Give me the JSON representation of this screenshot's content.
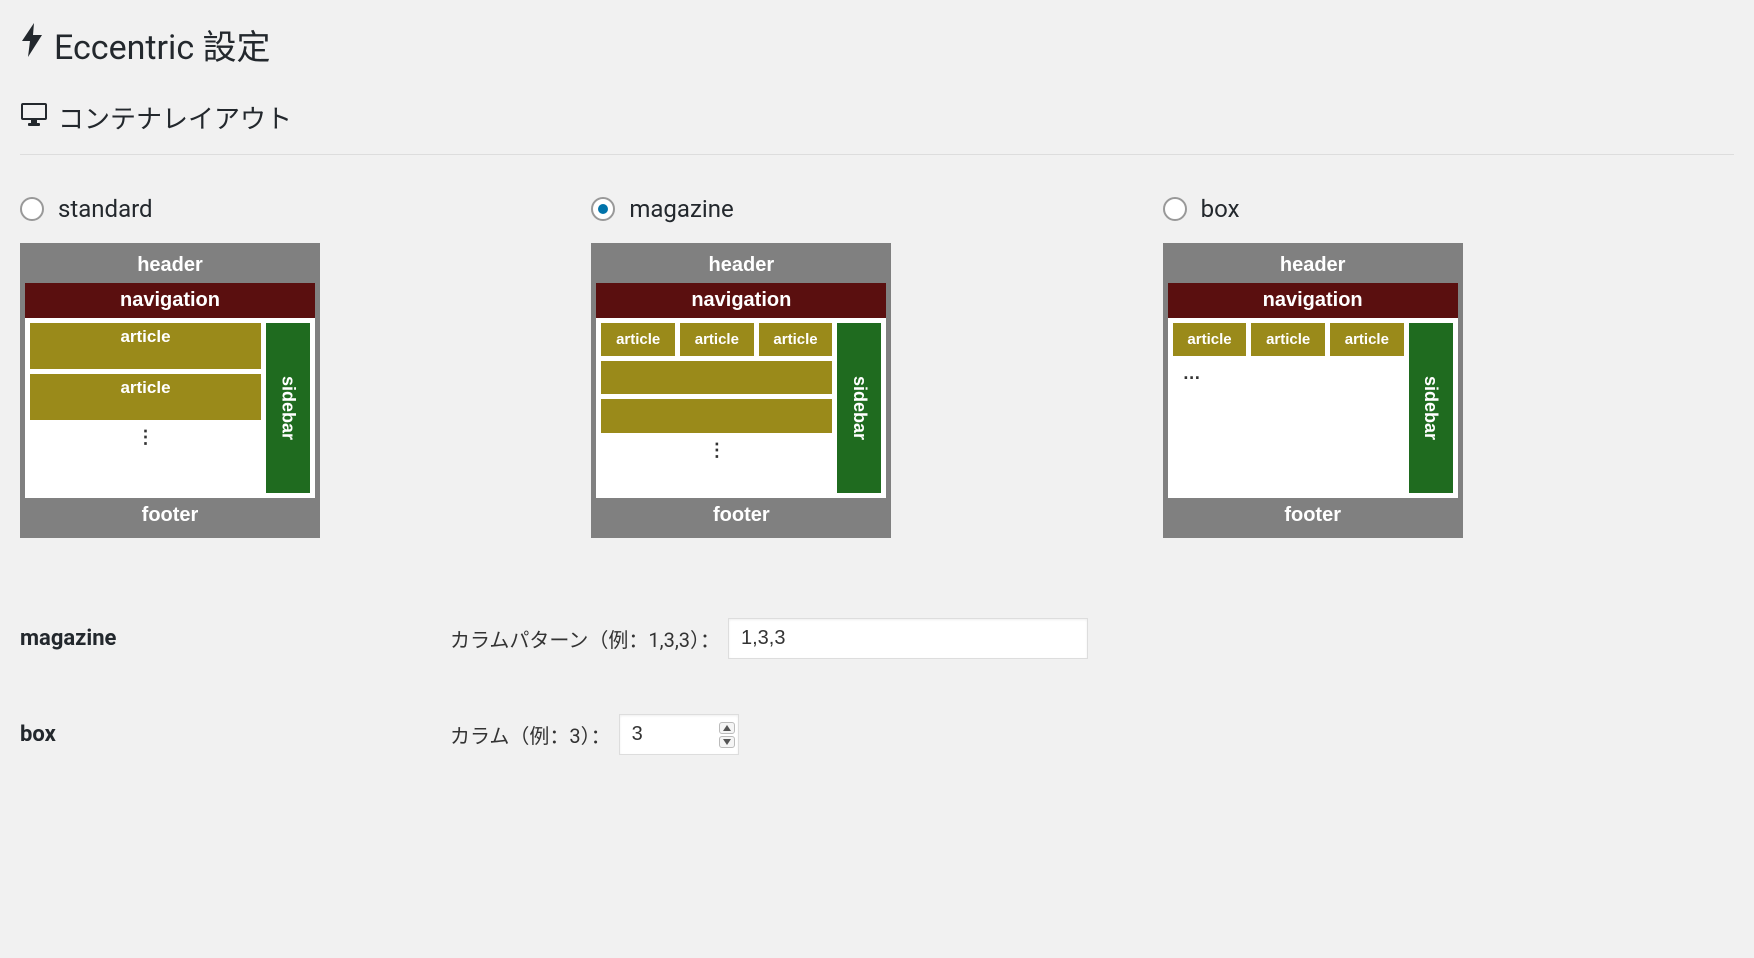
{
  "page": {
    "title": "Eccentric 設定",
    "section_title": "コンテナレイアウト"
  },
  "options": {
    "standard": {
      "label": "standard",
      "selected": false
    },
    "magazine": {
      "label": "magazine",
      "selected": true
    },
    "box": {
      "label": "box",
      "selected": false
    }
  },
  "thumb_text": {
    "header": "header",
    "navigation": "navigation",
    "article": "article",
    "sidebar": "sidebar",
    "footer": "footer"
  },
  "fields": {
    "magazine": {
      "row_label": "magazine",
      "field_label": "カラムパターン（例：1,3,3）：",
      "value": "1,3,3"
    },
    "box": {
      "row_label": "box",
      "field_label": "カラム（例：3）：",
      "value": "3"
    }
  }
}
